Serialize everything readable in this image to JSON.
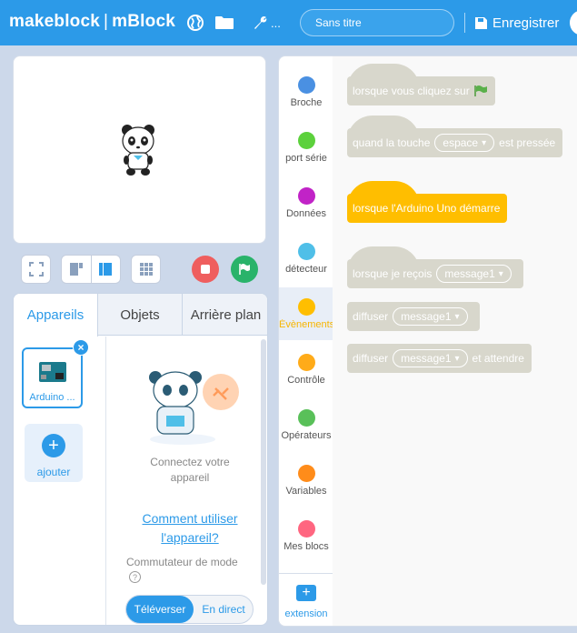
{
  "topbar": {
    "brand_left": "makeblock",
    "brand_sep": "|",
    "brand_right": "mBlock",
    "project_title": "Sans titre",
    "save_label": "Enregistrer",
    "wrench_menu": "..."
  },
  "stage": {
    "sprite_name": "panda"
  },
  "tabs": [
    "Appareils",
    "Objets",
    "Arrière plan"
  ],
  "devices": {
    "selected_label": "Arduino ...",
    "add_label": "ajouter",
    "connect_text_1": "Connectez votre",
    "connect_text_2": "appareil",
    "howto_1": "Comment utiliser",
    "howto_2": "l'appareil?",
    "mode_label": "Commutateur de mode",
    "help": "?",
    "mode_upload": "Téléverser",
    "mode_live": "En direct"
  },
  "categories": [
    {
      "name": "Broche",
      "color": "#4a90e2"
    },
    {
      "name": "port série",
      "color": "#5cd13c"
    },
    {
      "name": "Données",
      "color": "#c123c7"
    },
    {
      "name": "détecteur",
      "color": "#4fbfe8"
    },
    {
      "name": "Évènements",
      "color": "#ffbe00"
    },
    {
      "name": "Contrôle",
      "color": "#ffab19"
    },
    {
      "name": "Opérateurs",
      "color": "#59c059"
    },
    {
      "name": "Variables",
      "color": "#ff8c1a"
    },
    {
      "name": "Mes blocs",
      "color": "#ff6680"
    }
  ],
  "extension_label": "extension",
  "blocks": {
    "green_flag": "lorsque vous cliquez sur",
    "key_pressed_a": "quand la touche",
    "key_option": "espace",
    "key_pressed_b": "est pressée",
    "arduino_start": "lorsque l'Arduino Uno démarre",
    "receive_a": "lorsque je reçois",
    "message": "message1",
    "broadcast": "diffuser",
    "broadcast_wait_b": "et attendre"
  },
  "colors": {
    "accent": "#2c9ae8",
    "event_block": "#ffbe00",
    "inactive_block": "#d8d7cc",
    "stop": "#ef5e5e",
    "go": "#29b36a"
  }
}
